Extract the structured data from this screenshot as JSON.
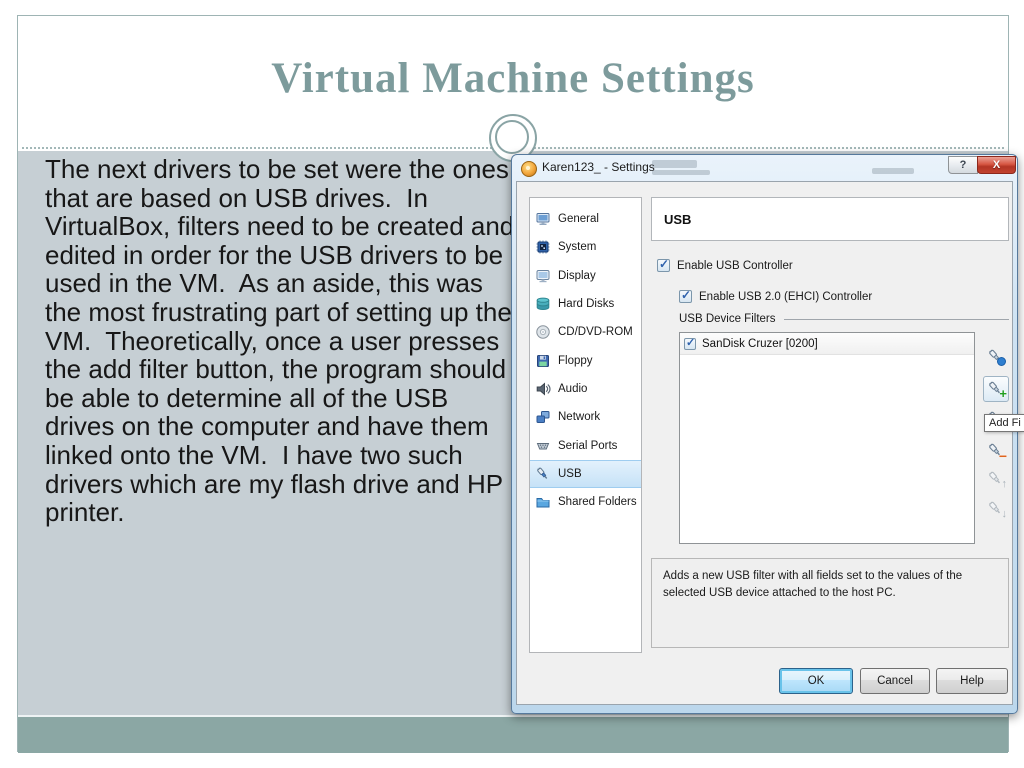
{
  "slide": {
    "title": "Virtual Machine Settings",
    "body_text": "The next drivers to be set were the ones that are based on USB drives.  In VirtualBox, filters need to be created and edited in order for the USB drivers to be used in the VM.  As an aside, this was the most frustrating part of setting up the VM.  Theoretically, once a user presses the add filter button, the program should be able to determine all of the USB drives on the computer and have them linked onto the VM.  I have two such drivers which are my flash drive and HP printer.",
    "colors": {
      "title_text": "#7d9b9c",
      "body_bg": "#c6cfd4",
      "footer_band": "#8ba7a4",
      "frame_border": "#9eb4b4"
    }
  },
  "dialog": {
    "title": "Karen123_ - Settings",
    "caption": {
      "help_label": "?",
      "close_label": "X"
    },
    "sidebar_items": [
      {
        "label": "General",
        "icon": "general-icon",
        "selected": false
      },
      {
        "label": "System",
        "icon": "system-icon",
        "selected": false
      },
      {
        "label": "Display",
        "icon": "display-icon",
        "selected": false
      },
      {
        "label": "Hard Disks",
        "icon": "hard-disks-icon",
        "selected": false
      },
      {
        "label": "CD/DVD-ROM",
        "icon": "cd-dvd-icon",
        "selected": false
      },
      {
        "label": "Floppy",
        "icon": "floppy-icon",
        "selected": false
      },
      {
        "label": "Audio",
        "icon": "audio-icon",
        "selected": false
      },
      {
        "label": "Network",
        "icon": "network-icon",
        "selected": false
      },
      {
        "label": "Serial Ports",
        "icon": "serial-ports-icon",
        "selected": false
      },
      {
        "label": "USB",
        "icon": "usb-icon",
        "selected": true
      },
      {
        "label": "Shared Folders",
        "icon": "shared-folders-icon",
        "selected": false
      }
    ],
    "usb_page": {
      "header": "USB",
      "enable_usb_label": "Enable USB Controller",
      "enable_usb_checked": true,
      "enable_ehci_label": "Enable USB 2.0 (EHCI) Controller",
      "enable_ehci_checked": true,
      "filters_group_label": "USB Device Filters",
      "filters": [
        {
          "label": "SanDisk Cruzer [0200]",
          "checked": true
        }
      ],
      "filter_actions": [
        {
          "name": "add-empty-filter",
          "badge": "circle",
          "disabled": false,
          "hovered": false
        },
        {
          "name": "add-filter-from-device",
          "badge": "plus",
          "disabled": false,
          "hovered": true
        },
        {
          "name": "edit-filter",
          "badge": "gold",
          "disabled": false,
          "hovered": false
        },
        {
          "name": "remove-filter",
          "badge": "minus",
          "disabled": false,
          "hovered": false
        },
        {
          "name": "move-filter-up",
          "badge": "up",
          "disabled": true,
          "hovered": false
        },
        {
          "name": "move-filter-down",
          "badge": "down",
          "disabled": true,
          "hovered": false
        }
      ],
      "tooltip": "Add Fi",
      "description": "Adds a new USB filter with all fields set to the values of the selected USB device attached to the host PC."
    },
    "buttons": {
      "ok": "OK",
      "cancel": "Cancel",
      "help": "Help"
    }
  }
}
